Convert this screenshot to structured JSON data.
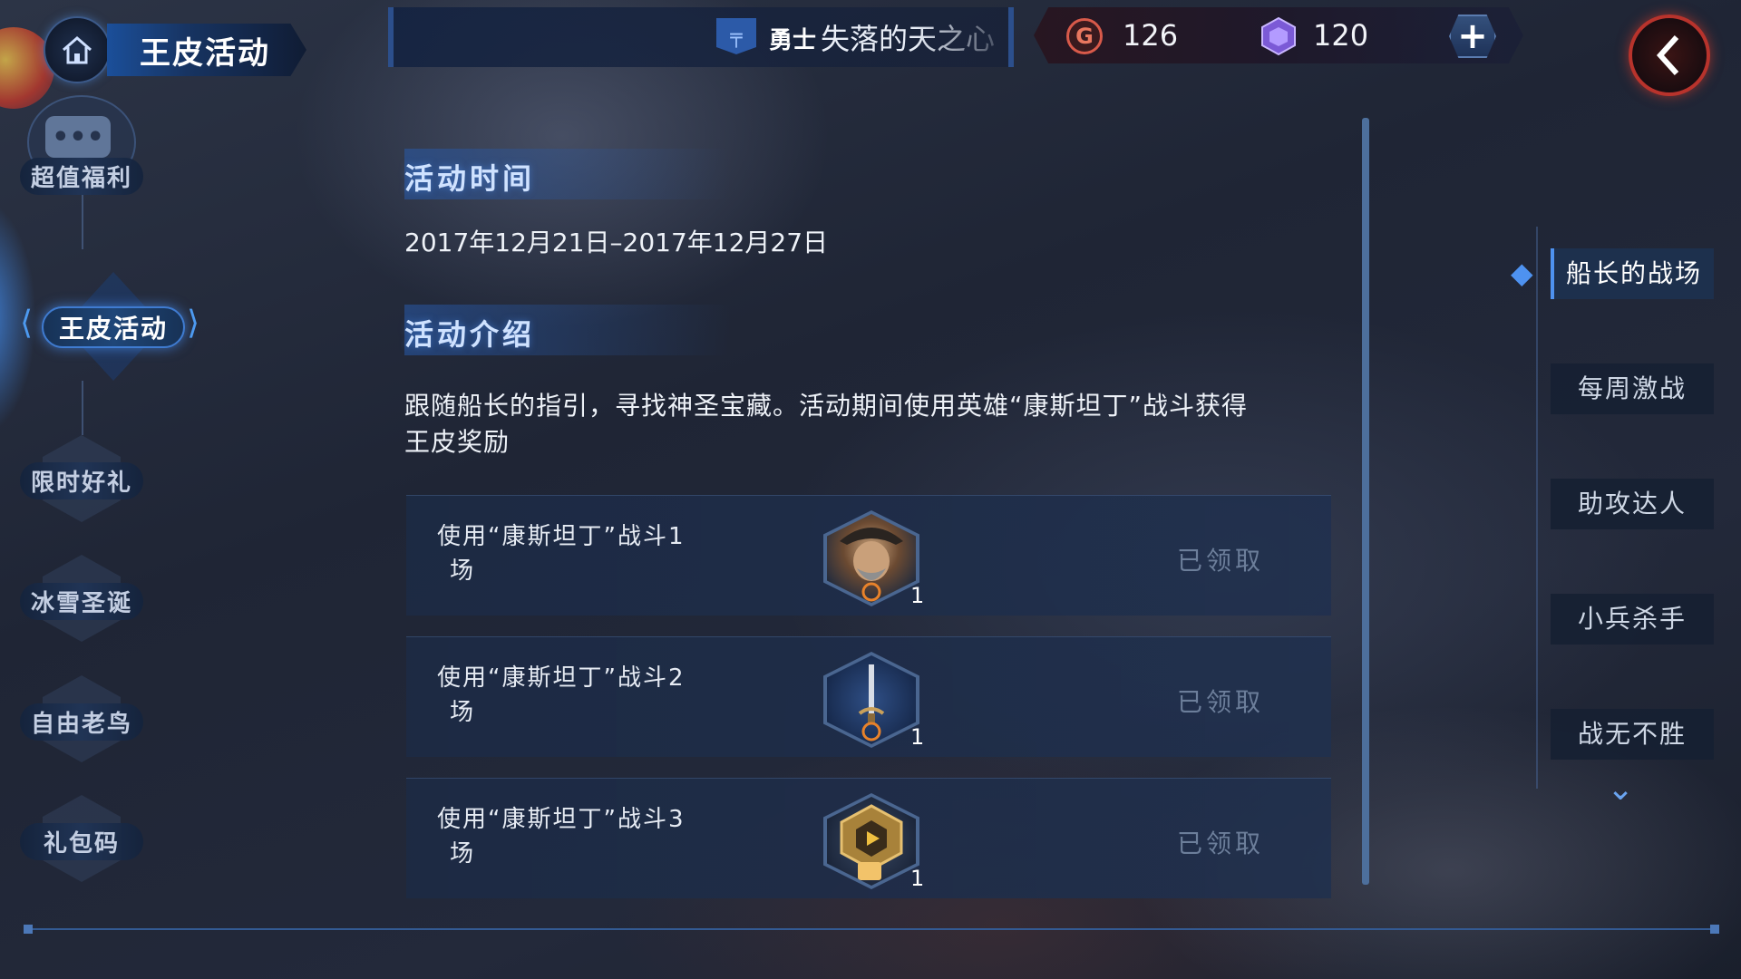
{
  "header": {
    "title": "王皮活动",
    "rank_label": "勇士",
    "player_name": "失落的天之心",
    "gold": "126",
    "gems": "120"
  },
  "sidebar": {
    "items": [
      {
        "label": "超值福利"
      },
      {
        "label": "王皮活动",
        "active": true
      },
      {
        "label": "限时好礼"
      },
      {
        "label": "冰雪圣诞"
      },
      {
        "label": "自由老鸟"
      },
      {
        "label": "礼包码"
      }
    ]
  },
  "main": {
    "time_title": "活动时间",
    "time_range": "2017年12月21日–2017年12月27日",
    "intro_title": "活动介绍",
    "intro_text": "跟随船长的指引，寻找神圣宝藏。活动期间使用英雄“康斯坦丁”战斗获得王皮奖励",
    "tasks": [
      {
        "line1": "使用“康斯坦丁”战斗1",
        "line2": "场",
        "reward_icon": "hero-portrait-icon",
        "qty": "1",
        "status": "已领取"
      },
      {
        "line1": "使用“康斯坦丁”战斗2",
        "line2": "场",
        "reward_icon": "sword-icon",
        "qty": "1",
        "status": "已领取"
      },
      {
        "line1": "使用“康斯坦丁”战斗3",
        "line2": "场",
        "reward_icon": "treasure-chest-icon",
        "qty": "1",
        "status": "已领取"
      }
    ]
  },
  "right_tabs": [
    {
      "label": "船长的战场",
      "active": true
    },
    {
      "label": "每周激战"
    },
    {
      "label": "助攻达人"
    },
    {
      "label": "小兵杀手"
    },
    {
      "label": "战无不胜"
    }
  ],
  "colors": {
    "accent": "#4e92f0",
    "back_button": "#b8332c",
    "claimed_text": "#6c7e9a"
  }
}
